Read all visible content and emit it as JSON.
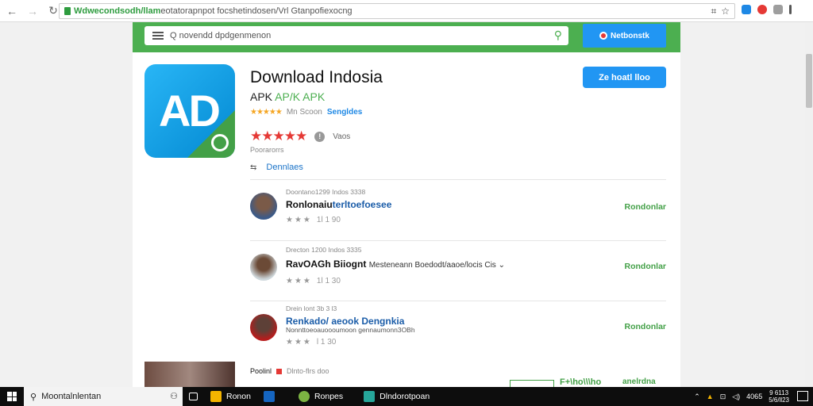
{
  "browser": {
    "url_host": "Wdwecondsodh/llam",
    "url_path": "eotatorapnpot focshetindosen/Vrl Gtanpofiexocng",
    "icons": [
      "back-arrow-icon",
      "forward-arrow-icon",
      "reload-icon",
      "lock-icon",
      "bookmark-star-icon"
    ]
  },
  "header": {
    "search_placeholder": "Q novendd dpdgenmenon",
    "button_label": "Netbonstk",
    "accent": "#4caf50",
    "button_color": "#2196f3"
  },
  "app": {
    "icon_letters": "AD",
    "title": "Download Indosia",
    "subtitle_parts": [
      "APK",
      "AP/K",
      "APK"
    ],
    "small_stars": "★★★★★",
    "meta_text": "Mn Scoon",
    "meta_link": "Sengldes",
    "big_stars": "★★★★★",
    "info_glyph": "!",
    "rating_text": "Vaos",
    "rating_count": "Poorarorrs",
    "dev_icon": "⇆",
    "dev_label": "Dennlaes",
    "download_button": "Ze hoatl lloo"
  },
  "reviews": [
    {
      "date": "Doontano1299 Indos 3338",
      "name": "Ronlonaiu",
      "name_extra": "terltoefoesee",
      "snippet": "",
      "stars": "★★★",
      "count": "1l 1 90",
      "action": "Rondonlar"
    },
    {
      "date": "Drecton 1200 Indos 3335",
      "name": "RavOAGh Biiognt",
      "name_extra": "Mesteneann Boedodt/aaoe/locis Cis ⌄",
      "snippet": "",
      "stars": "★★★",
      "count": "1l 1 30",
      "action": "Rondonlar"
    },
    {
      "date": "Drein lont 3b 3 l3",
      "name": "Renkado/ aeook Dengnkia",
      "name_extra": "",
      "snippet": "Nonnttoeoauoooumoon gennaumonn3OBh",
      "stars": "★★★",
      "count": "l 1 30",
      "action": "Rondonlar"
    }
  ],
  "bottom": {
    "label": "Poolinl",
    "label2": "Dlnto-flrs doo",
    "link": "F+\\ho\\\\\\ho",
    "link2": "anelrdna"
  },
  "taskbar": {
    "search_text": "Moontalnlentan",
    "items": [
      {
        "label": "Ronon",
        "color": "#f4b400"
      },
      {
        "label": "",
        "color": "#1565c0"
      },
      {
        "label": "Ronpes",
        "color": "#7cb342"
      },
      {
        "label": "Dlndorotpoan",
        "color": "#26a69a"
      }
    ],
    "tray_text": "4065",
    "clock_time": "9 6113",
    "clock_date": "5/6/ll23"
  }
}
